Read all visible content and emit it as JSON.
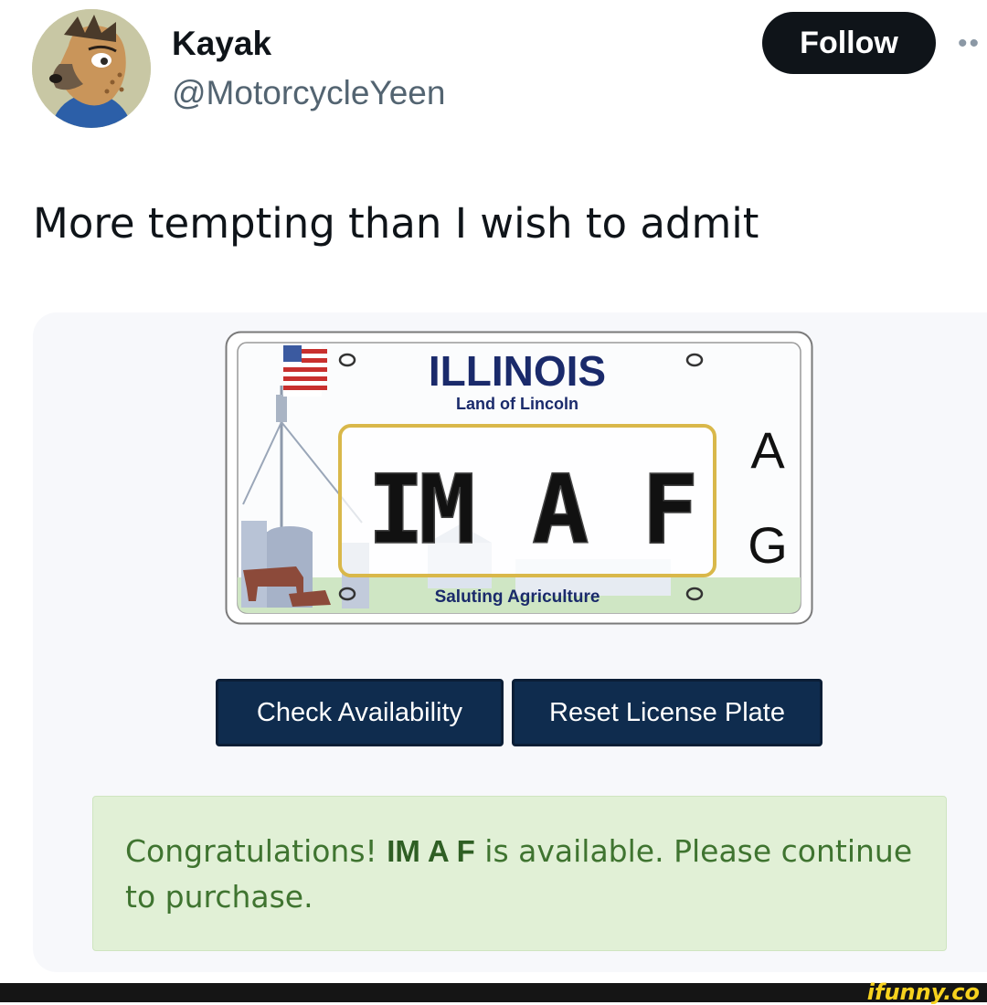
{
  "tweet": {
    "name": "Kayak",
    "handle": "@MotorcycleYeen",
    "follow_label": "Follow",
    "more_label": "••",
    "text": "More tempting than I wish to admit"
  },
  "plate": {
    "state": "ILLINOIS",
    "slogan": "Land of Lincoln",
    "characters": [
      "I",
      "M",
      "A",
      "F"
    ],
    "side_letters": [
      "A",
      "G"
    ],
    "tagline": "Saluting Agriculture"
  },
  "buttons": {
    "check": "Check Availability",
    "reset": "Reset License Plate"
  },
  "alert": {
    "prefix": "Congratulations! ",
    "plate_text": "IM A F",
    "suffix": " is available. Please continue to purchase."
  },
  "watermark": "ifunny.co",
  "colors": {
    "button_bg": "#0f2c4e",
    "alert_bg": "#e1f0d6",
    "alert_text": "#3f7430",
    "plate_title": "#1a2a6b",
    "plate_frame": "#d9b84a"
  }
}
